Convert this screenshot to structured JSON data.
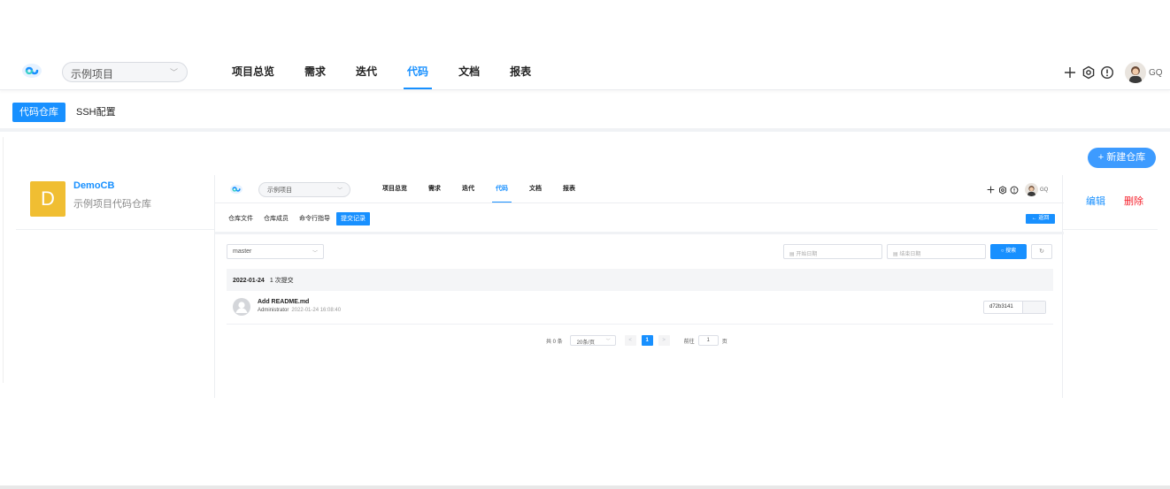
{
  "nav": {
    "project_select": "示例项目",
    "menu": [
      "项目总览",
      "需求",
      "迭代",
      "代码",
      "文档",
      "报表"
    ],
    "active_menu": "代码",
    "user_initials": "GQ"
  },
  "subtabs": {
    "active": "代码仓库",
    "second": "SSH配置"
  },
  "new_repo_button": "+ 新建仓库",
  "repo": {
    "icon_letter": "D",
    "name": "DemoCB",
    "description": "示例项目代码仓库",
    "edit": "编辑",
    "delete": "删除"
  },
  "inner": {
    "project_select": "示例项目",
    "menu": [
      "项目总览",
      "需求",
      "迭代",
      "代码",
      "文档",
      "报表"
    ],
    "user_initials": "GQ",
    "subtabs": [
      "仓库文件",
      "仓库成员",
      "命令行指导",
      "提交记录"
    ],
    "back_button": "← 返回",
    "branch": "master",
    "start_date_placeholder": "开始日期",
    "end_date_placeholder": "结束日期",
    "search_button": "搜索",
    "commit_date": "2022-01-24",
    "commit_count": "1 次提交",
    "commit": {
      "title": "Add README.md",
      "author": "Administrator",
      "time": "2022-01-24 16:08:40",
      "sha": "d72b3141"
    },
    "pager": {
      "total": "共 0 条",
      "page_size": "20条/页",
      "prev": "<",
      "page": "1",
      "next": ">",
      "goto_label": "前往",
      "goto_value": "1",
      "goto_suffix": "页"
    }
  },
  "colors": {
    "accent": "#1890ff",
    "repo_icon": "#f0be32",
    "danger": "#f5222d"
  }
}
